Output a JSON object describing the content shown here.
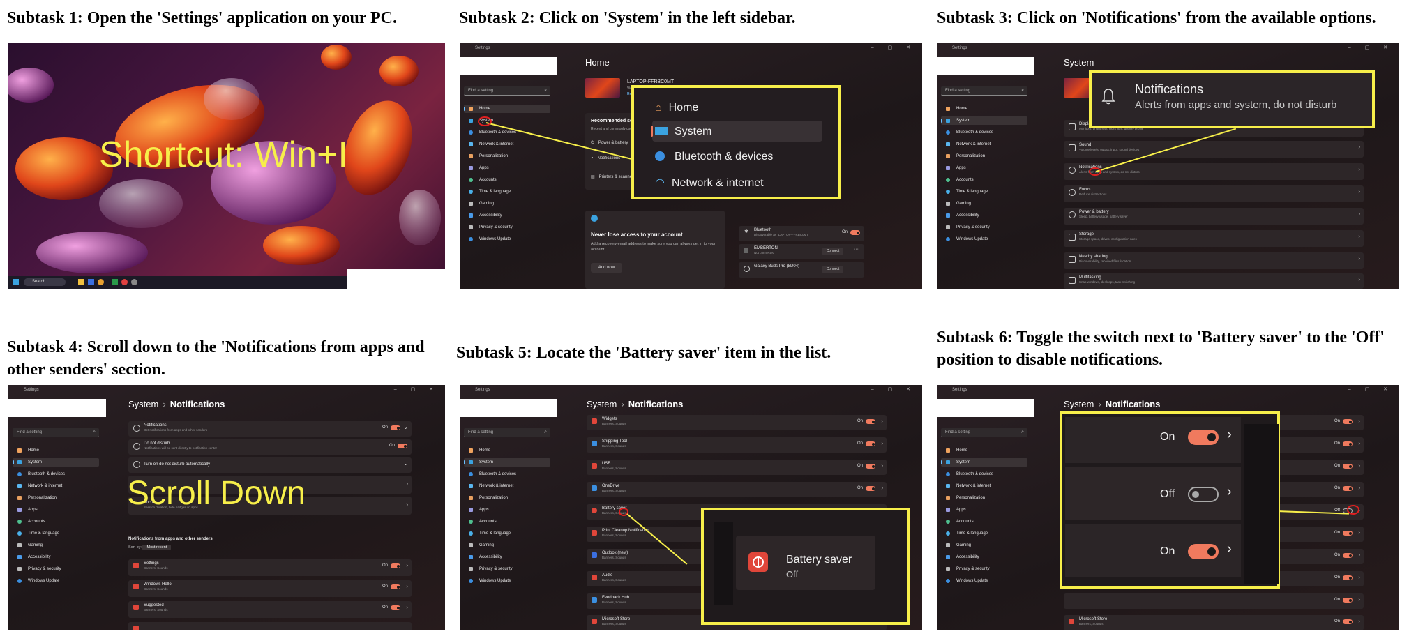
{
  "captions": {
    "s1": "Subtask 1: Open the 'Settings' application on your PC.",
    "s2": "Subtask 2: Click on 'System' in the left sidebar.",
    "s3": "Subtask 3: Click on 'Notifications' from the available options.",
    "s4": "Subtask 4: Scroll down to the 'Notifications from apps and other senders' section.",
    "s5": "Subtask 5: Locate the 'Battery saver' item in the list.",
    "s6": "Subtask 6: Toggle the switch next to 'Battery saver' to the 'Off' position to disable notifications."
  },
  "panel1": {
    "overlay": "Shortcut: Win+I",
    "taskbar_search": "Search"
  },
  "window": {
    "title": "Settings",
    "find_placeholder": "Find a setting",
    "controls": "–  ▢  ✕"
  },
  "sidebar": [
    {
      "label": "Home",
      "icon": "home-icon",
      "color": "#f0a35e"
    },
    {
      "label": "System",
      "icon": "monitor-icon",
      "color": "#3ba3e0"
    },
    {
      "label": "Bluetooth & devices",
      "icon": "bluetooth-icon",
      "color": "#3b8fe0"
    },
    {
      "label": "Network & internet",
      "icon": "wifi-icon",
      "color": "#5ab6ef"
    },
    {
      "label": "Personalization",
      "icon": "brush-icon",
      "color": "#e8a060"
    },
    {
      "label": "Apps",
      "icon": "apps-icon",
      "color": "#9a9ae0"
    },
    {
      "label": "Accounts",
      "icon": "person-icon",
      "color": "#4fbf8f"
    },
    {
      "label": "Time & language",
      "icon": "globe-icon",
      "color": "#4ab0e8"
    },
    {
      "label": "Gaming",
      "icon": "controller-icon",
      "color": "#bbb"
    },
    {
      "label": "Accessibility",
      "icon": "accessibility-icon",
      "color": "#4a9ae8"
    },
    {
      "label": "Privacy & security",
      "icon": "shield-icon",
      "color": "#bbb"
    },
    {
      "label": "Windows Update",
      "icon": "update-icon",
      "color": "#3b8fe0"
    }
  ],
  "panel2": {
    "page_title": "Home",
    "device_name": "LAPTOP-FFRBC0MT",
    "device_sub": "Victus by HP",
    "rename": "Rename",
    "recommended": "Recommended settings",
    "recommended_sub": "Recent and commonly used settings",
    "rows": [
      "Power & battery",
      "Notifications",
      "Printers & scanners"
    ],
    "account_title": "Never lose access to your account",
    "account_body": "Add a recovery email address to make sure you can always get in to your account",
    "add_now": "Add now",
    "bt_name": "Bluetooth",
    "bt_sub": "Discoverable as \"LAPTOP-FFRBC0MT\"",
    "on": "On",
    "dev1": "EMBERTON",
    "dev1_sub": "Not connected",
    "dev2": "Galaxy Buds Pro (8D04)",
    "connect": "Connect",
    "zoom_items": [
      "Home",
      "System",
      "Bluetooth & devices",
      "Network & internet"
    ]
  },
  "panel3": {
    "page_title": "System",
    "zoom_title": "Notifications",
    "zoom_sub": "Alerts from apps and system, do not disturb",
    "rows": [
      {
        "name": "Display",
        "sub": "Monitors, brightness, night light, display profile"
      },
      {
        "name": "Sound",
        "sub": "Volume levels, output, input, sound devices"
      },
      {
        "name": "Notifications",
        "sub": "Alerts from apps and system, do not disturb"
      },
      {
        "name": "Focus",
        "sub": "Reduce distractions"
      },
      {
        "name": "Power & battery",
        "sub": "Sleep, battery usage, battery saver"
      },
      {
        "name": "Storage",
        "sub": "Storage space, drives, configuration rules"
      },
      {
        "name": "Nearby sharing",
        "sub": "Discoverability, received files location"
      },
      {
        "name": "Multitasking",
        "sub": "Snap windows, desktops, task switching"
      }
    ]
  },
  "breadcrumb": {
    "parent": "System",
    "sep": "›",
    "current": "Notifications"
  },
  "panel4": {
    "overlay": "Scroll Down",
    "rows": [
      {
        "name": "Notifications",
        "sub": "Get notifications from apps and other senders",
        "state": "On"
      },
      {
        "name": "Do not disturb",
        "sub": "Notifications will be sent directly to notification center",
        "state": "On"
      },
      {
        "name": "Turn on do not disturb automatically",
        "sub": "",
        "state": ""
      },
      {
        "name": "",
        "sub": "",
        "state": ""
      },
      {
        "name": "Focus",
        "sub": "Session duration, hide badges on apps",
        "state": ""
      }
    ],
    "section": "Notifications from apps and other senders",
    "sort_label": "Sort by:",
    "sort_value": "Most recent",
    "apps": [
      {
        "name": "Settings",
        "sub": "Banners, Sounds",
        "state": "On"
      },
      {
        "name": "Windows Hello",
        "sub": "Banners, Sounds",
        "state": "On"
      },
      {
        "name": "Suggested",
        "sub": "Banners, Sounds",
        "state": "On"
      }
    ]
  },
  "panel5": {
    "apps": [
      {
        "name": "Widgets",
        "sub": "Banners, Sounds",
        "state": "On"
      },
      {
        "name": "Snipping Tool",
        "sub": "Banners, Sounds",
        "state": "On"
      },
      {
        "name": "USB",
        "sub": "Banners, Sounds",
        "state": "On"
      },
      {
        "name": "OneDrive",
        "sub": "Banners, Sounds",
        "state": "On"
      },
      {
        "name": "Battery saver",
        "sub": "Banners, Sounds",
        "state": "On"
      },
      {
        "name": "Print Cleanup Notification",
        "sub": "Banners, Sounds",
        "state": "On"
      },
      {
        "name": "Outlook (new)",
        "sub": "Banners, Sounds",
        "state": "On"
      },
      {
        "name": "Audio",
        "sub": "Banners, Sounds",
        "state": "On"
      },
      {
        "name": "Feedback Hub",
        "sub": "Banners, Sounds",
        "state": "On"
      },
      {
        "name": "Microsoft Store",
        "sub": "Banners, Sounds",
        "state": "On"
      }
    ],
    "zoom_name": "Battery saver",
    "zoom_state": "Off"
  },
  "panel6": {
    "rows_state": [
      "On",
      "On",
      "On",
      "On",
      "Off",
      "On",
      "On",
      "On",
      "On",
      "On"
    ],
    "sub": "Banners, Sounds",
    "last_app": "Microsoft Store",
    "zoom": [
      {
        "state": "On",
        "on": true
      },
      {
        "state": "Off",
        "on": false
      },
      {
        "state": "On",
        "on": true
      }
    ]
  },
  "colors": {
    "highlight": "#f7ef4a",
    "toggle_on": "#f07a5e",
    "marker": "#e02020"
  }
}
